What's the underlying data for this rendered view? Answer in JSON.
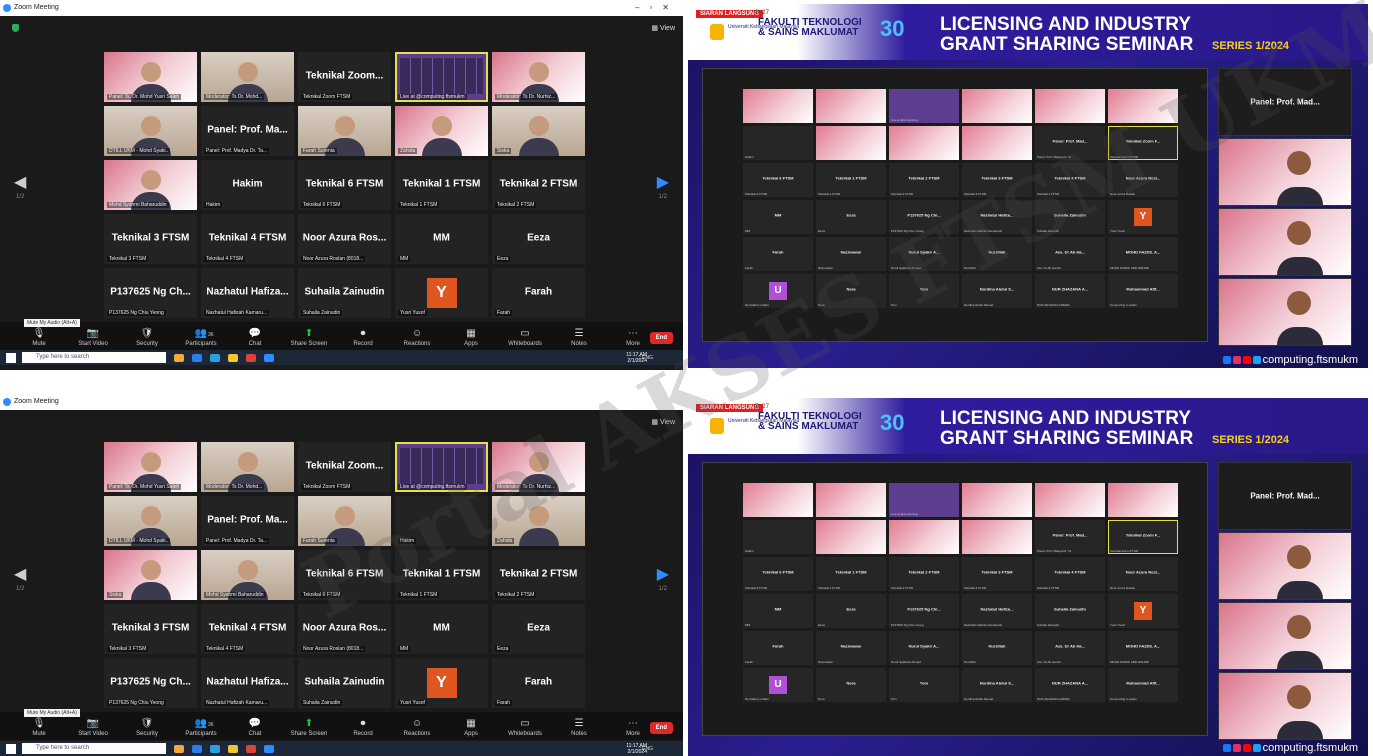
{
  "zoom": {
    "window_title": "Zoom Meeting",
    "view_label": "View",
    "page_indicator_left": "1/2",
    "page_indicator_right": "1/2",
    "mute_tooltip": "Mute My Audio (Alt+A)",
    "end_label": "End",
    "toolbar": [
      "Mute",
      "Start Video",
      "Security",
      "Participants",
      "Chat",
      "Share Screen",
      "Record",
      "Reactions",
      "Apps",
      "Whiteboards",
      "Notes",
      "More"
    ],
    "participant_count": "36",
    "grid_top": [
      {
        "kind": "video",
        "name": "",
        "caption": "Panel: Ts. Dr. Mohd Yusri Saleh"
      },
      {
        "kind": "video",
        "name": "",
        "caption": "Moderator: Ts Dr. Mohd..."
      },
      {
        "kind": "name",
        "name": "Teknikal Zoom...",
        "caption": "Teknikal Zoom FTSM"
      },
      {
        "kind": "share",
        "name": "",
        "caption": "Live at @computing.ftsmukm"
      },
      {
        "kind": "video",
        "name": "",
        "caption": "Moderator: Ts Dr. Nurhiz..."
      },
      {
        "kind": "video",
        "name": "",
        "caption": "DTILL UKM - Mohd Syaki.."
      },
      {
        "kind": "name",
        "name": "Panel: Prof. Ma...",
        "caption": "Panel: Prof. Madya Dr. Ta..."
      },
      {
        "kind": "video",
        "name": "",
        "caption": "Farah Surenia"
      },
      {
        "kind": "video",
        "name": "",
        "caption": "Zahida"
      },
      {
        "kind": "video",
        "name": "",
        "caption": "Siska"
      },
      {
        "kind": "video",
        "name": "",
        "caption": "Mohd Syahmi Baharuddin"
      },
      {
        "kind": "name",
        "name": "Hakim",
        "caption": "Hakim"
      },
      {
        "kind": "name",
        "name": "Teknikal 6 FTSM",
        "caption": "Teknikal 6 FTSM"
      },
      {
        "kind": "name",
        "name": "Teknikal 1 FTSM",
        "caption": "Teknikal 1 FTSM"
      },
      {
        "kind": "name",
        "name": "Teknikal 2 FTSM",
        "caption": "Teknikal 2 FTSM"
      },
      {
        "kind": "name",
        "name": "Teknikal 3 FTSM",
        "caption": "Teknikal 3 FTSM"
      },
      {
        "kind": "name",
        "name": "Teknikal 4 FTSM",
        "caption": "Teknikal 4 FTSM"
      },
      {
        "kind": "name",
        "name": "Noor Azura Ros...",
        "caption": "Noor Azura Roslan (8018..."
      },
      {
        "kind": "name",
        "name": "MM",
        "caption": "MM"
      },
      {
        "kind": "name",
        "name": "Eeza",
        "caption": "Eeza"
      },
      {
        "kind": "name",
        "name": "P137625 Ng Ch...",
        "caption": "P137625 Ng Chiu Yeong"
      },
      {
        "kind": "name",
        "name": "Nazhatul Hafiza...",
        "caption": "Nazhatul Hafizah Kamaru..."
      },
      {
        "kind": "name",
        "name": "Suhaila Zainudin",
        "caption": "Suhaila Zainudin"
      },
      {
        "kind": "letter",
        "name": "Y",
        "caption": "Yusri Yusof"
      },
      {
        "kind": "name",
        "name": "Farah",
        "caption": "Farah"
      }
    ],
    "grid_bottom": [
      {
        "kind": "video",
        "name": "",
        "caption": "Panel: Ts. Dr. Mohd Yusri Saleh"
      },
      {
        "kind": "video",
        "name": "",
        "caption": "Moderator: Ts Dr. Mohd..."
      },
      {
        "kind": "name",
        "name": "Teknikal Zoom...",
        "caption": "Teknikal Zoom FTSM"
      },
      {
        "kind": "share",
        "name": "",
        "caption": "Live at @computing.ftsmukm"
      },
      {
        "kind": "video",
        "name": "",
        "caption": "Moderator: Ts Dr. Nurhiz..."
      },
      {
        "kind": "video",
        "name": "",
        "caption": "DTILL UKM - Mohd Syaki.."
      },
      {
        "kind": "name",
        "name": "Panel: Prof. Ma...",
        "caption": "Panel: Prof. Madya Dr. Ta..."
      },
      {
        "kind": "video",
        "name": "",
        "caption": "Farah Surenia"
      },
      {
        "kind": "name",
        "name": "",
        "caption": "Hakim"
      },
      {
        "kind": "video",
        "name": "",
        "caption": "Zahida"
      },
      {
        "kind": "video",
        "name": "",
        "caption": "Siska"
      },
      {
        "kind": "video",
        "name": "",
        "caption": "Mohd Syahmi Baharuddin"
      },
      {
        "kind": "name",
        "name": "Teknikal 6 FTSM",
        "caption": "Teknikal 6 FTSM"
      },
      {
        "kind": "name",
        "name": "Teknikal 1 FTSM",
        "caption": "Teknikal 1 FTSM"
      },
      {
        "kind": "name",
        "name": "Teknikal 2 FTSM",
        "caption": "Teknikal 2 FTSM"
      },
      {
        "kind": "name",
        "name": "Teknikal 3 FTSM",
        "caption": "Teknikal 3 FTSM"
      },
      {
        "kind": "name",
        "name": "Teknikal 4 FTSM",
        "caption": "Teknikal 4 FTSM"
      },
      {
        "kind": "name",
        "name": "Noor Azura Ros...",
        "caption": "Noor Azura Roslan (8018..."
      },
      {
        "kind": "name",
        "name": "MM",
        "caption": "MM"
      },
      {
        "kind": "name",
        "name": "Eeza",
        "caption": "Eeza"
      },
      {
        "kind": "name",
        "name": "P137625 Ng Ch...",
        "caption": "P137625 Ng Chiu Yeong"
      },
      {
        "kind": "name",
        "name": "Nazhatul Hafiza...",
        "caption": "Nazhatul Hafizah Kamaru..."
      },
      {
        "kind": "name",
        "name": "Suhaila Zainudin",
        "caption": "Suhaila Zainudin"
      },
      {
        "kind": "letter",
        "name": "Y",
        "caption": "Yusri Yusof"
      },
      {
        "kind": "name",
        "name": "Farah",
        "caption": "Farah"
      }
    ]
  },
  "taskbar": {
    "search_placeholder": "Type here to search",
    "tray": "^  ENG",
    "time": "11:17 AM",
    "date": "2/1/2024"
  },
  "stream": {
    "live_label": "SIARAN LANGSUNG",
    "views": "27",
    "faculty_line1": "FAKULTI TEKNOLOGI",
    "faculty_line2": "& SAINS MAKLUMAT",
    "university": "Universiti Kebangsaan Malaysia",
    "anniversary": "30",
    "title_line1": "LICENSING AND INDUSTRY",
    "title_line2": "GRANT SHARING SEMINAR",
    "series": "SERIES 1/2024",
    "side_panel_name": "Panel: Prof. Mad...",
    "social_handle": "computing.ftsmukm",
    "share_tiles": [
      {
        "k": "v",
        "n": "",
        "c": "Panel: Ts. Dr. Mohd Yusri"
      },
      {
        "k": "v",
        "n": "",
        "c": "Moderator: Ts Dr. Mohd"
      },
      {
        "k": "sv",
        "n": "",
        "c": "Live at @computing"
      },
      {
        "k": "v",
        "n": "",
        "c": "Moderator: Ts Dr. Nurhiz"
      },
      {
        "k": "v",
        "n": "",
        "c": "DTILL UKM"
      },
      {
        "k": "v",
        "n": "",
        "c": "Farah Surenia"
      },
      {
        "k": "n",
        "n": "",
        "c": "Hakim"
      },
      {
        "k": "v",
        "n": "",
        "c": "Zahida"
      },
      {
        "k": "v",
        "n": "",
        "c": "Siska"
      },
      {
        "k": "v",
        "n": "",
        "c": "Mohd Syahmi"
      },
      {
        "k": "n",
        "n": "Panel: Prof. Mad...",
        "c": "Panel: Prof. Madya Dr. Ta"
      },
      {
        "k": "hl",
        "n": "Teknikal Zoom F...",
        "c": "Teknikal Zoom FTSM"
      },
      {
        "k": "n",
        "n": "Teknikal 6 FTSM",
        "c": "Teknikal 6 FTSM"
      },
      {
        "k": "n",
        "n": "Teknikal 1 FTSM",
        "c": "Teknikal 1 FTSM"
      },
      {
        "k": "n",
        "n": "Teknikal 2 FTSM",
        "c": "Teknikal 2 FTSM"
      },
      {
        "k": "n",
        "n": "Teknikal 3 FTSM",
        "c": "Teknikal 3 FTSM"
      },
      {
        "k": "n",
        "n": "Teknikal 4 FTSM",
        "c": "Teknikal 4 FTSM"
      },
      {
        "k": "n",
        "n": "Noor Azura Rosl...",
        "c": "Noor Azura Roslan"
      },
      {
        "k": "n",
        "n": "MM",
        "c": "MM"
      },
      {
        "k": "n",
        "n": "Eeza",
        "c": "Eeza"
      },
      {
        "k": "n",
        "n": "P137625 Ng Chi...",
        "c": "P137625 Ng Chiu Yeong"
      },
      {
        "k": "n",
        "n": "Nazhatul Hafiza...",
        "c": "Nazhatul Hafizah Kamarudin"
      },
      {
        "k": "n",
        "n": "Suhaila Zainudin",
        "c": "Suhaila Zainudin"
      },
      {
        "k": "y",
        "n": "Y",
        "c": "Yusri Yusof"
      },
      {
        "k": "n",
        "n": "Farah",
        "c": "Farah"
      },
      {
        "k": "n",
        "n": "Nazmawan",
        "c": "Nazmawan"
      },
      {
        "k": "n",
        "n": "Nurul Syakir A...",
        "c": "Nurul Syakirah Ahmad"
      },
      {
        "k": "n",
        "n": "Nurzillah",
        "c": "Nurzillah"
      },
      {
        "k": "n",
        "n": "Ass. Dr Ab Ha...",
        "c": "Ass. Dr Ab Hamid"
      },
      {
        "k": "n",
        "n": "MOHD FAZDIL A...",
        "c": "MOHD FAZDIL ABD WAHAB"
      },
      {
        "k": "u",
        "n": "U",
        "c": "Nurmalini Luriskin"
      },
      {
        "k": "n",
        "n": "Nora",
        "c": "Nora"
      },
      {
        "k": "n",
        "n": "Tom",
        "c": "Tom"
      },
      {
        "k": "n",
        "n": "Nordina Abdul S...",
        "c": "Nordina Abdul Samad"
      },
      {
        "k": "n",
        "n": "NUR ZHAZANA A...",
        "c": "NUR ZHAZANA AHMAD"
      },
      {
        "k": "n",
        "n": "Muhammad Afif...",
        "c": "Connecting to audio"
      }
    ]
  },
  "watermark": "Portal AKSES FTSM UKM",
  "colors": {
    "zoom_bg": "#1a1a1a",
    "accent_blue": "#2d8cff",
    "end_red": "#e02828",
    "avatar_orange": "#e0561f",
    "series_yellow": "#f7d21c",
    "banner_purple": "#2a1888"
  }
}
